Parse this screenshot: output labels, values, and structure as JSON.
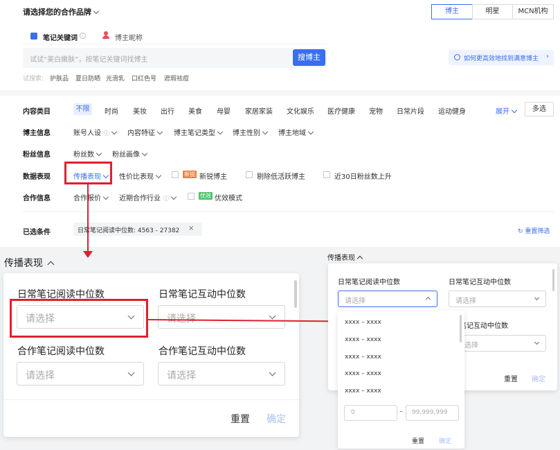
{
  "header": {
    "brand_select": "请选择您的合作品牌",
    "segments": [
      "博主",
      "明星",
      "MCN机构"
    ],
    "search_tabs": [
      "笔记关键词",
      "博主昵称"
    ],
    "search_placeholder": "试试“美白嫩肤”，按笔记关键词找博主",
    "search_button": "搜博主",
    "help_link": "如何更高效地找到满意博主",
    "try_label": "试搜索:",
    "try_items": [
      "护肤品",
      "夏日防晒",
      "光滑乳",
      "口红色号",
      "遮瑕祛痘"
    ]
  },
  "filters": {
    "content_category": {
      "label": "内容类目",
      "items": [
        "不限",
        "时尚",
        "美妆",
        "出行",
        "美食",
        "母婴",
        "家居家装",
        "文化娱乐",
        "医疗健康",
        "宠物",
        "日常片段",
        "运动健身"
      ],
      "expand": "展开",
      "multi": "多选"
    },
    "blogger_info": {
      "label": "博主信息",
      "items": [
        "账号人设",
        "内容特征",
        "博主笔记类型",
        "博主性别",
        "博主地域"
      ]
    },
    "fans_info": {
      "label": "粉丝信息",
      "items": [
        "粉丝数",
        "粉丝画像"
      ]
    },
    "data_perf": {
      "label": "数据表现",
      "items": [
        "传播表现",
        "性价比表现"
      ],
      "new_badge": "新锐",
      "new_label": "新锐博主",
      "low_active": "剔除低活跃博主",
      "fans_up": "近30日粉丝数上升"
    },
    "coop_info": {
      "label": "合作信息",
      "items": [
        "合作报价",
        "近期合作行业"
      ],
      "eff_badge": "优效",
      "eff_label": "优效模式"
    },
    "selected": {
      "label": "已选条件",
      "tag": "日常笔记阅读中位数: 4563 - 27382",
      "reset": "重置筛选"
    }
  },
  "zoom_left": {
    "title": "传播表现",
    "fields": [
      {
        "label": "日常笔记阅读中位数",
        "placeholder": "请选择"
      },
      {
        "label": "日常笔记互动中位数",
        "placeholder": "请选择"
      },
      {
        "label": "合作笔记阅读中位数",
        "placeholder": "请选择"
      },
      {
        "label": "合作笔记互动中位数",
        "placeholder": "请选择"
      }
    ],
    "reset": "重置",
    "confirm": "确定"
  },
  "zoom_right": {
    "title": "传播表现",
    "fields": [
      {
        "label": "日常笔记阅读中位数",
        "placeholder": "请选择"
      },
      {
        "label": "日常笔记互动中位数",
        "placeholder": "请选择"
      },
      {
        "label": "笔记互动中位数",
        "placeholder": "选择"
      }
    ],
    "reset": "重置",
    "confirm": "确定",
    "dropdown": {
      "options": [
        "xxxx – xxxx",
        "xxxx – xxxx",
        "xxxx – xxxx",
        "xxxx – xxxx",
        "xxxx – xxxx"
      ],
      "min_placeholder": "0",
      "max_placeholder": "99,999,999",
      "dash": "–",
      "reset": "重置",
      "confirm": "确定"
    }
  },
  "colors": {
    "accent": "#3a6df0",
    "highlight": "#e0202d"
  }
}
